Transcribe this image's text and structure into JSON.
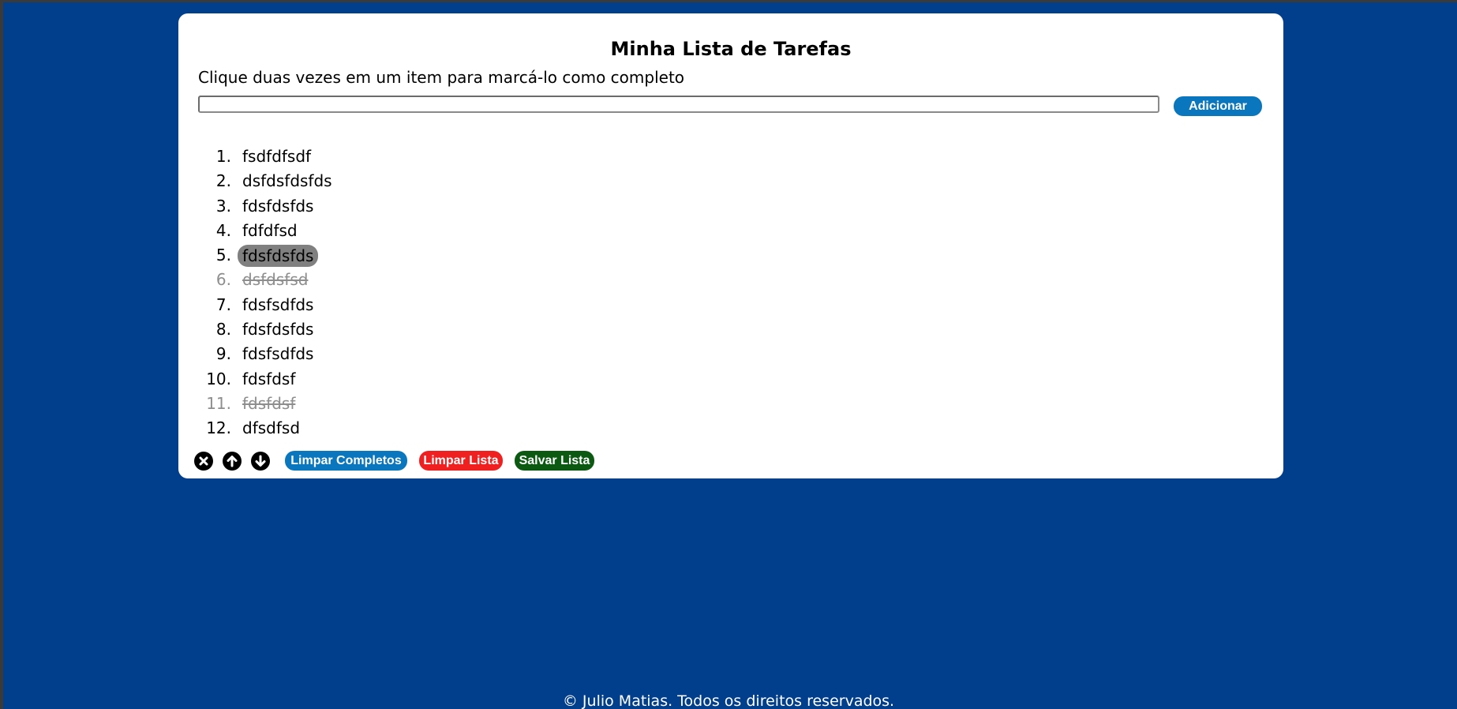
{
  "app": {
    "title": "Minha Lista de Tarefas",
    "instructions": "Clique duas vezes em um item para marcá-lo como completo"
  },
  "input": {
    "value": "",
    "placeholder": ""
  },
  "buttons": {
    "add": "Adicionar",
    "clear_completed": "Limpar Completos",
    "clear_list": "Limpar Lista",
    "save_list": "Salvar Lista"
  },
  "icons": {
    "remove": "close-circle-icon",
    "move_up": "arrow-up-circle-icon",
    "move_down": "arrow-down-circle-icon"
  },
  "tasks": [
    {
      "number": "1.",
      "text": "fsdfdfsdf",
      "completed": false,
      "selected": false
    },
    {
      "number": "2.",
      "text": "dsfdsfdsfds",
      "completed": false,
      "selected": false
    },
    {
      "number": "3.",
      "text": "fdsfdsfds",
      "completed": false,
      "selected": false
    },
    {
      "number": "4.",
      "text": "fdfdfsd",
      "completed": false,
      "selected": false
    },
    {
      "number": "5.",
      "text": "fdsfdsfds",
      "completed": false,
      "selected": true
    },
    {
      "number": "6.",
      "text": "dsfdsfsd",
      "completed": true,
      "selected": false
    },
    {
      "number": "7.",
      "text": "fdsfsdfds",
      "completed": false,
      "selected": false
    },
    {
      "number": "8.",
      "text": "fdsfdsfds",
      "completed": false,
      "selected": false
    },
    {
      "number": "9.",
      "text": "fdsfsdfds",
      "completed": false,
      "selected": false
    },
    {
      "number": "10.",
      "text": "fdsfdsf",
      "completed": false,
      "selected": false
    },
    {
      "number": "11.",
      "text": "fdsfdsf",
      "completed": true,
      "selected": false
    },
    {
      "number": "12.",
      "text": "dfsdfsd",
      "completed": false,
      "selected": false
    }
  ],
  "footer": "© Julio Matias. Todos os direitos reservados.",
  "colors": {
    "background": "#013e8c",
    "primary_button": "#0a76bd",
    "danger_button": "#f02020",
    "success_button": "#0c5a12",
    "selected_item": "#808080",
    "completed_text": "#8e8e8e"
  }
}
